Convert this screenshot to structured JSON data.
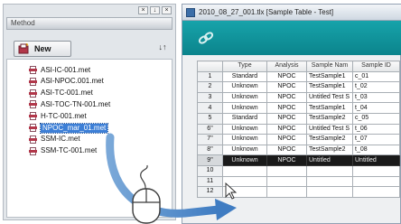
{
  "method_pane": {
    "header": "Method",
    "new_label": "New",
    "sort_glyph": "↓↑",
    "window_controls": [
      "×",
      "↓",
      "×"
    ],
    "items": [
      {
        "name": "ASI-IC-001.met",
        "selected": false
      },
      {
        "name": "ASI-NPOC.001.met",
        "selected": false
      },
      {
        "name": "ASI-TC-001.met",
        "selected": false
      },
      {
        "name": "ASI-TOC-TN-001.met",
        "selected": false
      },
      {
        "name": "H-TC-001.met",
        "selected": false
      },
      {
        "name": "NPOC_mar_01.met",
        "selected": true
      },
      {
        "name": "SSM-IC.met",
        "selected": false
      },
      {
        "name": "SSM-TC-001.met",
        "selected": false
      }
    ]
  },
  "table_window": {
    "title": "2010_08_27_001.tlx [Sample Table - Test]",
    "columns": [
      "",
      "Type",
      "Analysis",
      "Sample Nam",
      "Sample ID"
    ],
    "rows": [
      {
        "num": "1",
        "type": "Standard",
        "analysis": "NPOC",
        "sample_name": "TestSample1",
        "sample_id": "c_01"
      },
      {
        "num": "2",
        "type": "Unknown",
        "analysis": "NPOC",
        "sample_name": "TestSample1",
        "sample_id": "t_02"
      },
      {
        "num": "3",
        "type": "Unknown",
        "analysis": "NPOC",
        "sample_name": "Untitled Test S",
        "sample_id": "t_03"
      },
      {
        "num": "4",
        "type": "Unknown",
        "analysis": "NPOC",
        "sample_name": "TestSample1",
        "sample_id": "t_04"
      },
      {
        "num": "5",
        "type": "Standard",
        "analysis": "NPOC",
        "sample_name": "TestSample2",
        "sample_id": "c_05"
      },
      {
        "num": "6\"",
        "type": "Unknown",
        "analysis": "NPOC",
        "sample_name": "Untitled Test S",
        "sample_id": "t_06"
      },
      {
        "num": "7\"",
        "type": "Unknown",
        "analysis": "NPOC",
        "sample_name": "TestSample2",
        "sample_id": "t_07"
      },
      {
        "num": "8\"",
        "type": "Unknown",
        "analysis": "NPOC",
        "sample_name": "TestSample2",
        "sample_id": "t_08"
      },
      {
        "num": "9\"",
        "type": "Unknown",
        "analysis": "NPOC",
        "sample_name": "Untitled",
        "sample_id": "Untitled",
        "highlight": true
      },
      {
        "num": "10",
        "type": "",
        "analysis": "",
        "sample_name": "",
        "sample_id": ""
      },
      {
        "num": "11",
        "type": "",
        "analysis": "",
        "sample_name": "",
        "sample_id": ""
      },
      {
        "num": "12",
        "type": "",
        "analysis": "",
        "sample_name": "",
        "sample_id": ""
      }
    ]
  },
  "colors": {
    "toolbar_teal": "#0f959c",
    "selection_blue": "#3d7fd6",
    "drag_arrow": "#4d87c7",
    "file_icon_red": "#b2374a"
  },
  "icons": {
    "new": "new-method-icon",
    "file": "method-file-icon",
    "link": "link-icon",
    "mouse": "mouse-icon",
    "arrow": "drag-arrow-icon",
    "cursor": "cursor-icon"
  }
}
